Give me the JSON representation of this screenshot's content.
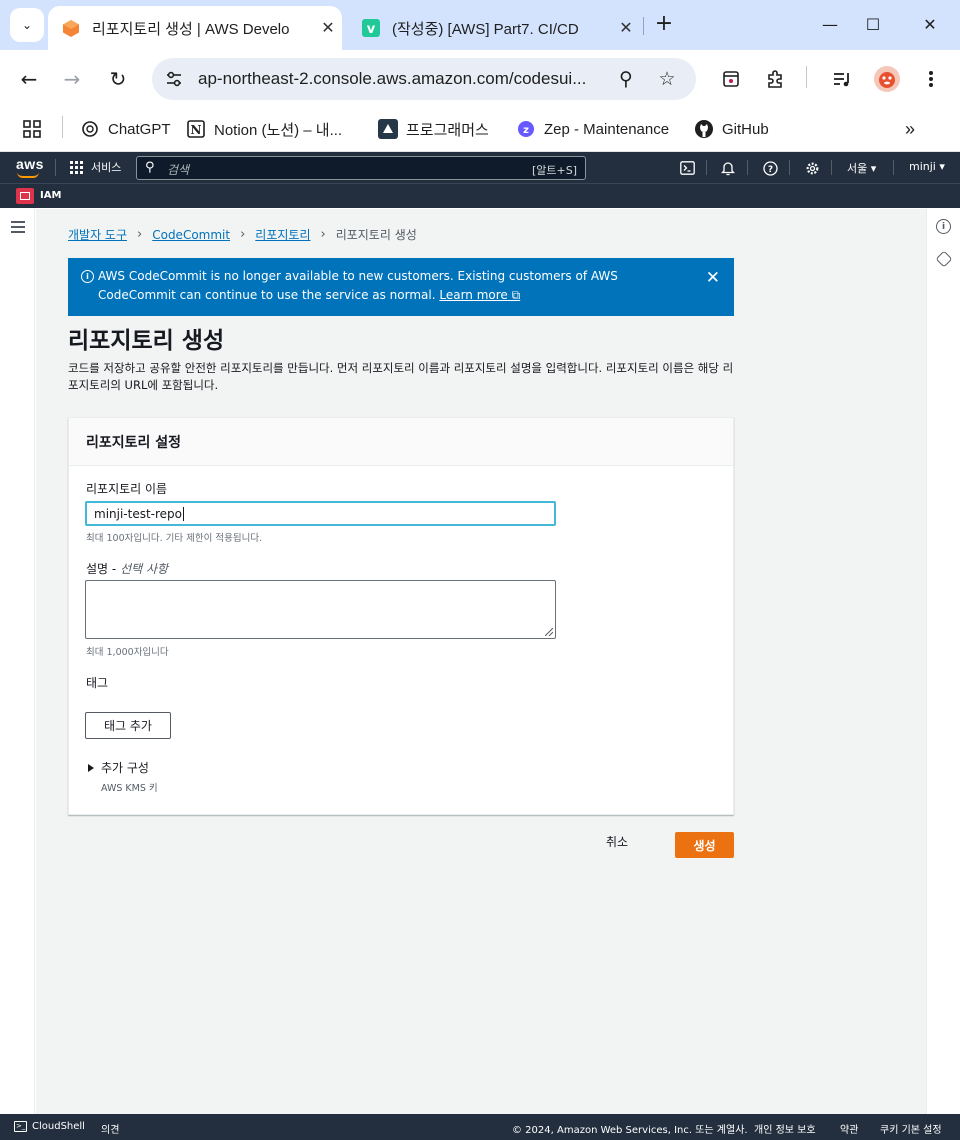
{
  "browser": {
    "tabs": [
      {
        "title": "리포지토리 생성 | AWS Develo",
        "active": true
      },
      {
        "title": "(작성중) [AWS] Part7. CI/CD",
        "active": false
      }
    ],
    "url": "ap-northeast-2.console.aws.amazon.com/codesui...",
    "bookmarks": [
      {
        "label": "ChatGPT",
        "icon": "chatgpt-icon"
      },
      {
        "label": "Notion (노션) – 내...",
        "icon": "notion-icon"
      },
      {
        "label": "프로그래머스",
        "icon": "programmers-icon"
      },
      {
        "label": "Zep - Maintenance",
        "icon": "zep-icon"
      },
      {
        "label": "GitHub",
        "icon": "github-icon"
      }
    ]
  },
  "aws": {
    "logo": "aws",
    "services_label": "서비스",
    "search_placeholder": "검색",
    "search_shortcut": "[알트+S]",
    "region": "서울 ▾",
    "user": "minji ▾",
    "favorite_label": "IAM"
  },
  "breadcrumb": {
    "items": [
      "개발자 도구",
      "CodeCommit",
      "리포지토리"
    ],
    "current": "리포지토리 생성"
  },
  "flash": {
    "message": "AWS CodeCommit is no longer available to new customers. Existing customers of AWS CodeCommit can continue to use the service as normal.",
    "link": "Learn more"
  },
  "page": {
    "title": "리포지토리 생성",
    "description": "코드를 저장하고 공유할 안전한 리포지토리를 만듭니다. 먼저 리포지토리 이름과 리포지토리 설명을 입력합니다. 리포지토리 이름은 해당 리포지토리의 URL에 포함됩니다."
  },
  "form": {
    "section_title": "리포지토리 설정",
    "name_label": "리포지토리 이름",
    "name_value": "minji-test-repo",
    "name_hint": "최대 100자입니다. 기타 제한이 적용됩니다.",
    "desc_label": "설명",
    "desc_optional": "선택 사항",
    "desc_hint": "최대 1,000자입니다",
    "tags_label": "태그",
    "add_tag_button": "태그 추가",
    "additional_config": "추가 구성",
    "additional_config_sub": "AWS KMS 키"
  },
  "actions": {
    "cancel": "취소",
    "create": "생성"
  },
  "footer": {
    "cloudshell": "CloudShell",
    "feedback": "의견",
    "copyright": "© 2024, Amazon Web Services, Inc. 또는 계열사.",
    "privacy": "개인 정보 보호",
    "terms": "약관",
    "cookies": "쿠키 기본 설정"
  },
  "colors": {
    "aws_nav": "#232f3e",
    "flash_blue": "#0073bb",
    "primary_orange": "#ec7211",
    "link": "#0073bb",
    "tabbar": "#d3e3fd"
  }
}
